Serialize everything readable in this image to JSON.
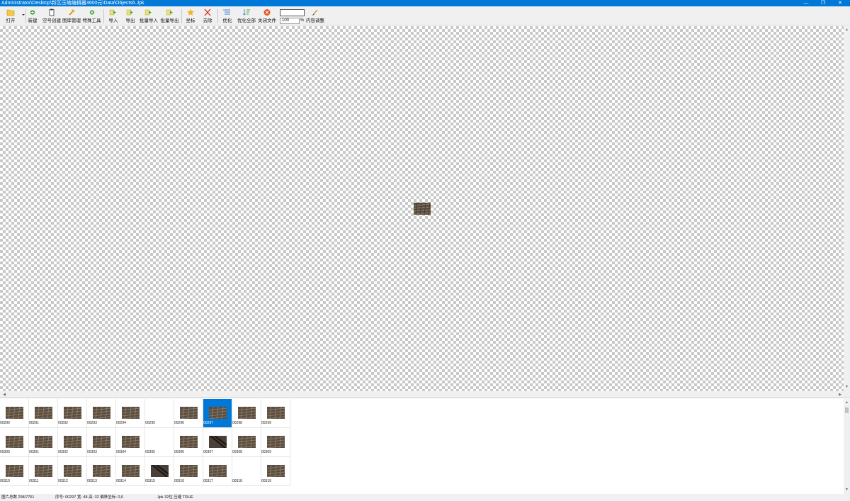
{
  "window": {
    "title": "Administrator\\Desktop\\新区压缩编辑器3600元\\Data\\Objects6.Jpk",
    "minimize": "—",
    "maximize": "❐",
    "close": "✕"
  },
  "toolbar": {
    "open": "打开",
    "new": "新建",
    "empty_create": "空号创建",
    "image_manage": "图库管理",
    "special_tools": "特殊工具",
    "import": "导入",
    "export": "导出",
    "batch_import": "批量导入",
    "batch_export": "批量导出",
    "favorite": "坐标",
    "delete": "去除",
    "optimize": "优化",
    "optimize_all": "优化全部",
    "close_file": "关闭文件",
    "zoom_value": "100",
    "zoom_unit": "%",
    "brush": "内容调整"
  },
  "icons": {
    "open": "folder-icon",
    "new": "plus-icon",
    "empty_create": "clipboard-icon",
    "image_manage": "wrench-icon",
    "special_tools": "gear-icon",
    "import": "arrow-right-icon",
    "export": "arrow-right-icon",
    "batch_import": "arrow-right-icon",
    "batch_export": "arrow-right-icon",
    "favorite": "star-icon",
    "delete": "x-icon",
    "optimize": "list-icon",
    "optimize_all": "sort-icon",
    "close_file": "stop-icon",
    "brush": "brush-icon"
  },
  "colors": {
    "accent": "#0078d7",
    "tile_dark": "#5a4c3e",
    "tile_light": "#8a7b68",
    "arrow_green": "#3aa33a",
    "star_gold": "#f3b21b",
    "delete_red": "#e02020"
  },
  "thumbnails": [
    {
      "id": "00290",
      "label": "00290",
      "type": "tile"
    },
    {
      "id": "00291",
      "label": "00291",
      "type": "tile"
    },
    {
      "id": "00292",
      "label": "00292",
      "type": "tile"
    },
    {
      "id": "00293",
      "label": "00293",
      "type": "tile"
    },
    {
      "id": "00294",
      "label": "00294",
      "type": "tile"
    },
    {
      "id": "00295",
      "label": "00295",
      "type": "blank"
    },
    {
      "id": "00296",
      "label": "00296",
      "type": "tile"
    },
    {
      "id": "00297",
      "label": "00297",
      "type": "tile",
      "selected": true
    },
    {
      "id": "00298",
      "label": "00298",
      "type": "tile"
    },
    {
      "id": "00299",
      "label": "00299",
      "type": "tile"
    },
    {
      "id": "00300",
      "label": "00300",
      "type": "tile"
    },
    {
      "id": "00301",
      "label": "00301",
      "type": "tile"
    },
    {
      "id": "00302",
      "label": "00302",
      "type": "tile"
    },
    {
      "id": "00303",
      "label": "00303",
      "type": "tile"
    },
    {
      "id": "00304",
      "label": "00304",
      "type": "tile"
    },
    {
      "id": "00305",
      "label": "00305",
      "type": "blank"
    },
    {
      "id": "00306",
      "label": "00306",
      "type": "tile"
    },
    {
      "id": "00307",
      "label": "00307",
      "type": "stripe"
    },
    {
      "id": "00308",
      "label": "00308",
      "type": "tile"
    },
    {
      "id": "00309",
      "label": "00309",
      "type": "tile"
    },
    {
      "id": "00310",
      "label": "00310",
      "type": "tile"
    },
    {
      "id": "00311",
      "label": "00311",
      "type": "tile"
    },
    {
      "id": "00312",
      "label": "00312",
      "type": "tile"
    },
    {
      "id": "00313",
      "label": "00313",
      "type": "tile"
    },
    {
      "id": "00314",
      "label": "00314",
      "type": "tile"
    },
    {
      "id": "00315",
      "label": "00315",
      "type": "stripe"
    },
    {
      "id": "00316",
      "label": "00316",
      "type": "tile"
    },
    {
      "id": "00317",
      "label": "00317",
      "type": "tile"
    },
    {
      "id": "00318",
      "label": "00318",
      "type": "blank"
    },
    {
      "id": "00319",
      "label": "00319",
      "type": "tile"
    }
  ],
  "status": {
    "count": "图片总数 298/7751",
    "index": "序号: 00297  宽: 48  高: 32  偏移坐标: 0,0",
    "format": "Jpk  32位  压缩  TRUE"
  }
}
